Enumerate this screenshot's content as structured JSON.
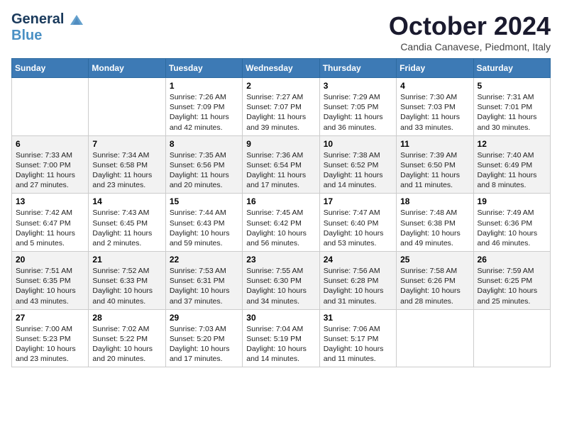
{
  "header": {
    "logo_line1": "General",
    "logo_line2": "Blue",
    "month_title": "October 2024",
    "location": "Candia Canavese, Piedmont, Italy"
  },
  "weekdays": [
    "Sunday",
    "Monday",
    "Tuesday",
    "Wednesday",
    "Thursday",
    "Friday",
    "Saturday"
  ],
  "weeks": [
    [
      {
        "day": "",
        "info": ""
      },
      {
        "day": "",
        "info": ""
      },
      {
        "day": "1",
        "info": "Sunrise: 7:26 AM\nSunset: 7:09 PM\nDaylight: 11 hours\nand 42 minutes."
      },
      {
        "day": "2",
        "info": "Sunrise: 7:27 AM\nSunset: 7:07 PM\nDaylight: 11 hours\nand 39 minutes."
      },
      {
        "day": "3",
        "info": "Sunrise: 7:29 AM\nSunset: 7:05 PM\nDaylight: 11 hours\nand 36 minutes."
      },
      {
        "day": "4",
        "info": "Sunrise: 7:30 AM\nSunset: 7:03 PM\nDaylight: 11 hours\nand 33 minutes."
      },
      {
        "day": "5",
        "info": "Sunrise: 7:31 AM\nSunset: 7:01 PM\nDaylight: 11 hours\nand 30 minutes."
      }
    ],
    [
      {
        "day": "6",
        "info": "Sunrise: 7:33 AM\nSunset: 7:00 PM\nDaylight: 11 hours\nand 27 minutes."
      },
      {
        "day": "7",
        "info": "Sunrise: 7:34 AM\nSunset: 6:58 PM\nDaylight: 11 hours\nand 23 minutes."
      },
      {
        "day": "8",
        "info": "Sunrise: 7:35 AM\nSunset: 6:56 PM\nDaylight: 11 hours\nand 20 minutes."
      },
      {
        "day": "9",
        "info": "Sunrise: 7:36 AM\nSunset: 6:54 PM\nDaylight: 11 hours\nand 17 minutes."
      },
      {
        "day": "10",
        "info": "Sunrise: 7:38 AM\nSunset: 6:52 PM\nDaylight: 11 hours\nand 14 minutes."
      },
      {
        "day": "11",
        "info": "Sunrise: 7:39 AM\nSunset: 6:50 PM\nDaylight: 11 hours\nand 11 minutes."
      },
      {
        "day": "12",
        "info": "Sunrise: 7:40 AM\nSunset: 6:49 PM\nDaylight: 11 hours\nand 8 minutes."
      }
    ],
    [
      {
        "day": "13",
        "info": "Sunrise: 7:42 AM\nSunset: 6:47 PM\nDaylight: 11 hours\nand 5 minutes."
      },
      {
        "day": "14",
        "info": "Sunrise: 7:43 AM\nSunset: 6:45 PM\nDaylight: 11 hours\nand 2 minutes."
      },
      {
        "day": "15",
        "info": "Sunrise: 7:44 AM\nSunset: 6:43 PM\nDaylight: 10 hours\nand 59 minutes."
      },
      {
        "day": "16",
        "info": "Sunrise: 7:45 AM\nSunset: 6:42 PM\nDaylight: 10 hours\nand 56 minutes."
      },
      {
        "day": "17",
        "info": "Sunrise: 7:47 AM\nSunset: 6:40 PM\nDaylight: 10 hours\nand 53 minutes."
      },
      {
        "day": "18",
        "info": "Sunrise: 7:48 AM\nSunset: 6:38 PM\nDaylight: 10 hours\nand 49 minutes."
      },
      {
        "day": "19",
        "info": "Sunrise: 7:49 AM\nSunset: 6:36 PM\nDaylight: 10 hours\nand 46 minutes."
      }
    ],
    [
      {
        "day": "20",
        "info": "Sunrise: 7:51 AM\nSunset: 6:35 PM\nDaylight: 10 hours\nand 43 minutes."
      },
      {
        "day": "21",
        "info": "Sunrise: 7:52 AM\nSunset: 6:33 PM\nDaylight: 10 hours\nand 40 minutes."
      },
      {
        "day": "22",
        "info": "Sunrise: 7:53 AM\nSunset: 6:31 PM\nDaylight: 10 hours\nand 37 minutes."
      },
      {
        "day": "23",
        "info": "Sunrise: 7:55 AM\nSunset: 6:30 PM\nDaylight: 10 hours\nand 34 minutes."
      },
      {
        "day": "24",
        "info": "Sunrise: 7:56 AM\nSunset: 6:28 PM\nDaylight: 10 hours\nand 31 minutes."
      },
      {
        "day": "25",
        "info": "Sunrise: 7:58 AM\nSunset: 6:26 PM\nDaylight: 10 hours\nand 28 minutes."
      },
      {
        "day": "26",
        "info": "Sunrise: 7:59 AM\nSunset: 6:25 PM\nDaylight: 10 hours\nand 25 minutes."
      }
    ],
    [
      {
        "day": "27",
        "info": "Sunrise: 7:00 AM\nSunset: 5:23 PM\nDaylight: 10 hours\nand 23 minutes."
      },
      {
        "day": "28",
        "info": "Sunrise: 7:02 AM\nSunset: 5:22 PM\nDaylight: 10 hours\nand 20 minutes."
      },
      {
        "day": "29",
        "info": "Sunrise: 7:03 AM\nSunset: 5:20 PM\nDaylight: 10 hours\nand 17 minutes."
      },
      {
        "day": "30",
        "info": "Sunrise: 7:04 AM\nSunset: 5:19 PM\nDaylight: 10 hours\nand 14 minutes."
      },
      {
        "day": "31",
        "info": "Sunrise: 7:06 AM\nSunset: 5:17 PM\nDaylight: 10 hours\nand 11 minutes."
      },
      {
        "day": "",
        "info": ""
      },
      {
        "day": "",
        "info": ""
      }
    ]
  ]
}
